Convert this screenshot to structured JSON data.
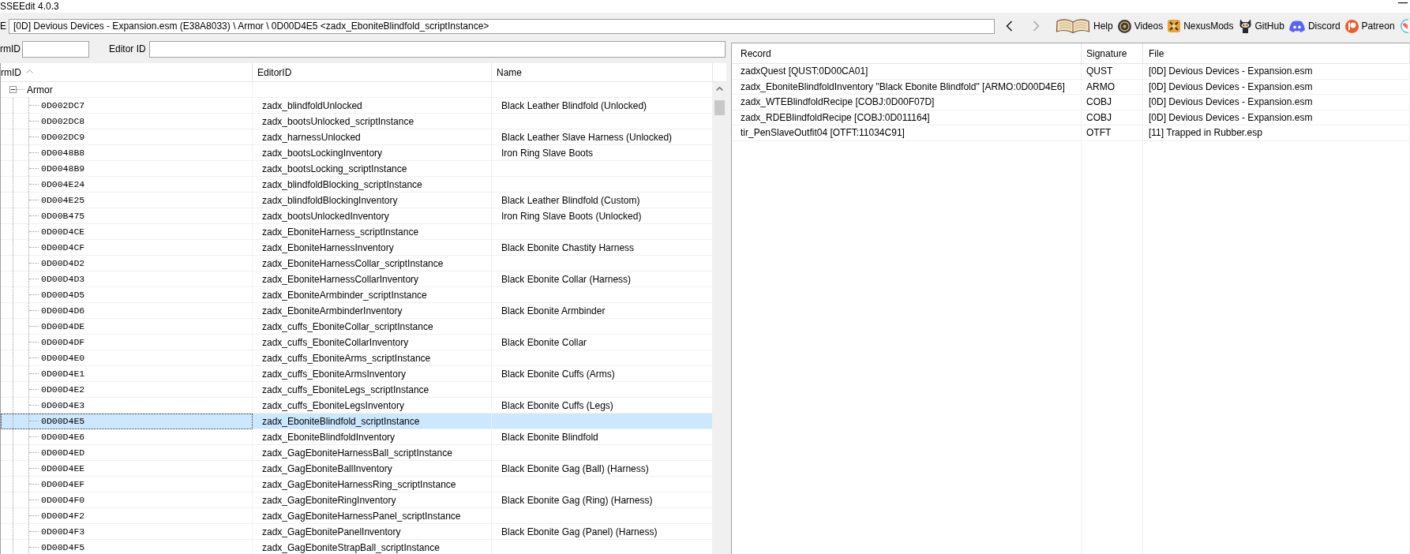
{
  "window": {
    "title": "SSEEdit 4.0.3"
  },
  "path_bar": {
    "label": "E",
    "value": "[0D] Devious Devices - Expansion.esm (E38A8033) \\ Armor \\ 0D00D4E5 <zadx_EboniteBlindfold_scriptInstance>"
  },
  "navigation": [
    {
      "disabled": false
    },
    {
      "disabled": true
    }
  ],
  "links": [
    {
      "label": "Help"
    },
    {
      "label": "Videos"
    },
    {
      "label": "NexusMods"
    },
    {
      "label": "GitHub"
    },
    {
      "label": "Discord"
    },
    {
      "label": "Patreon"
    }
  ],
  "filters": [
    {
      "label": "rmID"
    },
    {
      "label": "Editor ID"
    }
  ],
  "tree": {
    "columns": [
      {
        "label": "rmID",
        "sorted": true
      },
      {
        "label": "EditorID",
        "sorted": false
      },
      {
        "label": "Name",
        "sorted": false
      }
    ],
    "nodes": [
      {
        "label": "Armor",
        "expanded": true,
        "selected": false,
        "children": [
          {
            "form_id": "0D002DC7",
            "editor_id": "zadx_blindfoldUnlocked",
            "name": "Black Leather Blindfold (Unlocked)",
            "selected": false
          },
          {
            "form_id": "0D002DC8",
            "editor_id": "zadx_bootsUnlocked_scriptInstance",
            "selected": false
          },
          {
            "form_id": "0D002DC9",
            "editor_id": "zadx_harnessUnlocked",
            "name": "Black Leather Slave Harness (Unlocked)",
            "selected": false
          },
          {
            "form_id": "0D0048B8",
            "editor_id": "zadx_bootsLockingInventory",
            "name": "Iron Ring Slave Boots",
            "selected": false
          },
          {
            "form_id": "0D0048B9",
            "editor_id": "zadx_bootsLocking_scriptInstance",
            "selected": false
          },
          {
            "form_id": "0D004E24",
            "editor_id": "zadx_blindfoldBlocking_scriptInstance",
            "selected": false
          },
          {
            "form_id": "0D004E25",
            "editor_id": "zadx_blindfoldBlockingInventory",
            "name": "Black Leather Blindfold (Custom)",
            "selected": false
          },
          {
            "form_id": "0D00B475",
            "editor_id": "zadx_bootsUnlockedInventory",
            "name": "Iron Ring Slave Boots (Unlocked)",
            "selected": false
          },
          {
            "form_id": "0D00D4CE",
            "editor_id": "zadx_EboniteHarness_scriptInstance",
            "selected": false
          },
          {
            "form_id": "0D00D4CF",
            "editor_id": "zadx_EboniteHarnessInventory",
            "name": "Black Ebonite Chastity Harness",
            "selected": false
          },
          {
            "form_id": "0D00D4D2",
            "editor_id": "zadx_EboniteHarnessCollar_scriptInstance",
            "selected": false
          },
          {
            "form_id": "0D00D4D3",
            "editor_id": "zadx_EboniteHarnessCollarInventory",
            "name": "Black Ebonite Collar (Harness)",
            "selected": false
          },
          {
            "form_id": "0D00D4D5",
            "editor_id": "zadx_EboniteArmbinder_scriptInstance",
            "selected": false
          },
          {
            "form_id": "0D00D4D6",
            "editor_id": "zadx_EboniteArmbinderInventory",
            "name": "Black Ebonite Armbinder",
            "selected": false
          },
          {
            "form_id": "0D00D4DE",
            "editor_id": "zadx_cuffs_EboniteCollar_scriptInstance",
            "selected": false
          },
          {
            "form_id": "0D00D4DF",
            "editor_id": "zadx_cuffs_EboniteCollarInventory",
            "name": "Black Ebonite Collar",
            "selected": false
          },
          {
            "form_id": "0D00D4E0",
            "editor_id": "zadx_cuffs_EboniteArms_scriptInstance",
            "selected": false
          },
          {
            "form_id": "0D00D4E1",
            "editor_id": "zadx_cuffs_EboniteArmsInventory",
            "name": "Black Ebonite Cuffs (Arms)",
            "selected": false
          },
          {
            "form_id": "0D00D4E2",
            "editor_id": "zadx_cuffs_EboniteLegs_scriptInstance",
            "selected": false
          },
          {
            "form_id": "0D00D4E3",
            "editor_id": "zadx_cuffs_EboniteLegsInventory",
            "name": "Black Ebonite Cuffs (Legs)",
            "selected": false
          },
          {
            "form_id": "0D00D4E5",
            "editor_id": "zadx_EboniteBlindfold_scriptInstance",
            "selected": true
          },
          {
            "form_id": "0D00D4E6",
            "editor_id": "zadx_EboniteBlindfoldInventory",
            "name": "Black Ebonite Blindfold",
            "selected": false
          },
          {
            "form_id": "0D00D4ED",
            "editor_id": "zadx_GagEboniteHarnessBall_scriptInstance",
            "selected": false
          },
          {
            "form_id": "0D00D4EE",
            "editor_id": "zadx_GagEboniteBallInventory",
            "name": "Black Ebonite Gag (Ball) (Harness)",
            "selected": false
          },
          {
            "form_id": "0D00D4EF",
            "editor_id": "zadx_GagEboniteHarnessRing_scriptInstance",
            "selected": false
          },
          {
            "form_id": "0D00D4F0",
            "editor_id": "zadx_GagEboniteRingInventory",
            "name": "Black Ebonite Gag (Ring) (Harness)",
            "selected": false
          },
          {
            "form_id": "0D00D4F2",
            "editor_id": "zadx_GagEboniteHarnessPanel_scriptInstance",
            "selected": false
          },
          {
            "form_id": "0D00D4F3",
            "editor_id": "zadx_GagEbonitePanelInventory",
            "name": "Black Ebonite Gag (Panel) (Harness)",
            "selected": false
          },
          {
            "form_id": "0D00D4F5",
            "editor_id": "zadx_GagEboniteStrapBall_scriptInstance",
            "selected": false
          }
        ]
      }
    ]
  },
  "references": {
    "columns": [
      "Record",
      "Signature",
      "File"
    ],
    "rows": [
      {
        "record": "zadxQuest [QUST:0D00CA01]",
        "signature": "QUST",
        "file": "[0D] Devious Devices - Expansion.esm"
      },
      {
        "record": "zadx_EboniteBlindfoldInventory \"Black Ebonite Blindfold\" [ARMO:0D00D4E6]",
        "signature": "ARMO",
        "file": "[0D] Devious Devices - Expansion.esm"
      },
      {
        "record": "zadx_WTEBlindfoldRecipe [COBJ:0D00F07D]",
        "signature": "COBJ",
        "file": "[0D] Devious Devices - Expansion.esm"
      },
      {
        "record": "zadx_RDEBlindfoldRecipe [COBJ:0D011164]",
        "signature": "COBJ",
        "file": "[0D] Devious Devices - Expansion.esm"
      },
      {
        "record": "tir_PenSlaveOutfit04 [OTFT:11034C91]",
        "signature": "OTFT",
        "file": "[11] Trapped in Rubber.esp"
      }
    ]
  }
}
